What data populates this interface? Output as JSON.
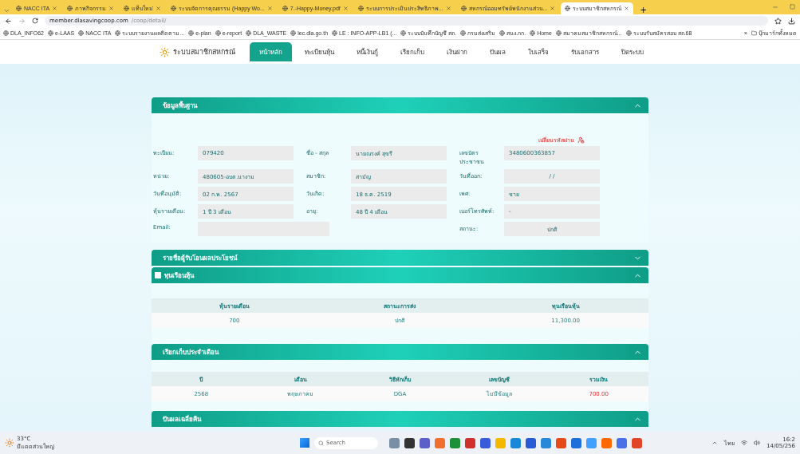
{
  "browser": {
    "tabs": [
      {
        "title": "NACC ITA",
        "selected": false
      },
      {
        "title": "ภาพกิจกรรม",
        "selected": false
      },
      {
        "title": "แท็บใหม่",
        "selected": false
      },
      {
        "title": "ระบบจัดการคุณธรรม (Happy Wo...",
        "selected": false
      },
      {
        "title": "7.-Happy-Money.pdf",
        "selected": false
      },
      {
        "title": "ระบบการประเมินประสิทธิภาพ...",
        "selected": false
      },
      {
        "title": "สหกรณ์ออมทรัพย์พนักงานส่วน...",
        "selected": false
      },
      {
        "title": "ระบบสมาชิกสหกรณ์",
        "selected": true
      }
    ],
    "new_tab": "+",
    "address": {
      "domain": "member.dlasavingcoop.com",
      "path": "/coop/detail/"
    },
    "bookmarks": [
      {
        "label": "DLA_INFO62"
      },
      {
        "label": "e-LAAS"
      },
      {
        "label": "NACC ITA"
      },
      {
        "label": "ระบบรายงานผลติดตาม..."
      },
      {
        "label": "e-plan"
      },
      {
        "label": "e-report"
      },
      {
        "label": "DLA_WASTE"
      },
      {
        "label": "lec.dla.go.th"
      },
      {
        "label": "LE : INFO-APP-LB1 (..."
      },
      {
        "label": "ระบบบันทึกบัญชี สถ."
      },
      {
        "label": "กรมส่งเสริม"
      },
      {
        "label": "สนง.กก."
      },
      {
        "label": "Home"
      },
      {
        "label": "สมาคมสมาชิกสหกรณ์..."
      },
      {
        "label": "ระบบรับสมัครสอบ สถ.68"
      }
    ],
    "bookmark_overflow": "»",
    "all_bookmarks": "บุ๊กมาร์กทั้งหมด"
  },
  "site": {
    "logo_text": "ระบบสมาชิกสหกรณ์",
    "nav": [
      {
        "label": "หน้าหลัก",
        "selected": true
      },
      {
        "label": "ทะเบียนหุ้น",
        "selected": false
      },
      {
        "label": "หนี้เงินกู้",
        "selected": false
      },
      {
        "label": "เรียกเก็บ",
        "selected": false
      },
      {
        "label": "เงินฝาก",
        "selected": false
      },
      {
        "label": "ปันผล",
        "selected": false
      },
      {
        "label": "ใบเสร็จ",
        "selected": false
      },
      {
        "label": "รับเอกสาร",
        "selected": false
      },
      {
        "label": "ปิดระบบ",
        "selected": false
      }
    ]
  },
  "profile": {
    "title": "ข้อมูลพื้นฐาน",
    "expanded": true,
    "change_password": "เปลี่ยนรหัสผ่าน",
    "fields": [
      {
        "label": "ทะเบียน:",
        "value": "079420",
        "kind": "normal"
      },
      {
        "label": "ชื่อ - สกุล",
        "value": "นายณรงค์ สุขรี",
        "kind": "normal"
      },
      {
        "label": "เลขบัตรประชาชน",
        "value": "3480600363857",
        "kind": "normal"
      },
      {
        "label": "หน่วย:",
        "value": "480605-อบต.นางาม",
        "kind": "normal"
      },
      {
        "label": "สมาชิก:",
        "value": "สามัญ",
        "kind": "normal"
      },
      {
        "label": "วันที่ออก:",
        "value": "/ /",
        "kind": "centered"
      },
      {
        "label": "วันที่อนุมัติ:",
        "value": "02 ก.พ. 2567",
        "kind": "normal"
      },
      {
        "label": "วันเกิด:",
        "value": "18 ธ.ค. 2519",
        "kind": "normal"
      },
      {
        "label": "เพศ:",
        "value": "ชาย",
        "kind": "normal"
      },
      {
        "label": "หุ้นรายเดือน:",
        "value": "1 ปี 3 เดือน",
        "kind": "normal"
      },
      {
        "label": "อายุ:",
        "value": "48 ปี 4 เดือน",
        "kind": "normal"
      },
      {
        "label": "เบอร์โทรศัพท์:",
        "value": "-",
        "kind": "normal"
      },
      {
        "label": "Email:",
        "kind": "wide"
      },
      {
        "label": "สถานะ:",
        "value": "ปกติ",
        "kind": "centered"
      }
    ]
  },
  "beneficiaries": {
    "title": "รายชื่อผู้รับโอนผลประโยชน์",
    "expanded": false
  },
  "shares": {
    "title": "ทุนเรือนหุ้น",
    "expanded": true,
    "checked": false,
    "columns": [
      "หุ้นรายเดือน",
      "สถานะการส่ง",
      "ทุนเรือนหุ้น"
    ],
    "rows": [
      [
        "700",
        "ปกติ",
        "11,300.00"
      ]
    ]
  },
  "billing": {
    "title": "เรียกเก็บประจำเดือน",
    "expanded": true,
    "columns": [
      "ปี",
      "เดือน",
      "วิธีหักเก็บ",
      "เลขบัญชี",
      "รวมเงิน"
    ],
    "rows": [
      [
        "2568",
        "พฤษภาคม",
        "DGA",
        "ไม่มีข้อมูล",
        "700.00"
      ]
    ]
  },
  "dividend": {
    "title": "ปันผลเฉลี่ยคืน",
    "expanded": true
  },
  "taskbar": {
    "temperature": "33°C",
    "weather": "มีแดดส่วนใหญ่",
    "search_placeholder": "Search",
    "language": "ไทย",
    "time": "16:2",
    "date": "14/05/256"
  }
}
